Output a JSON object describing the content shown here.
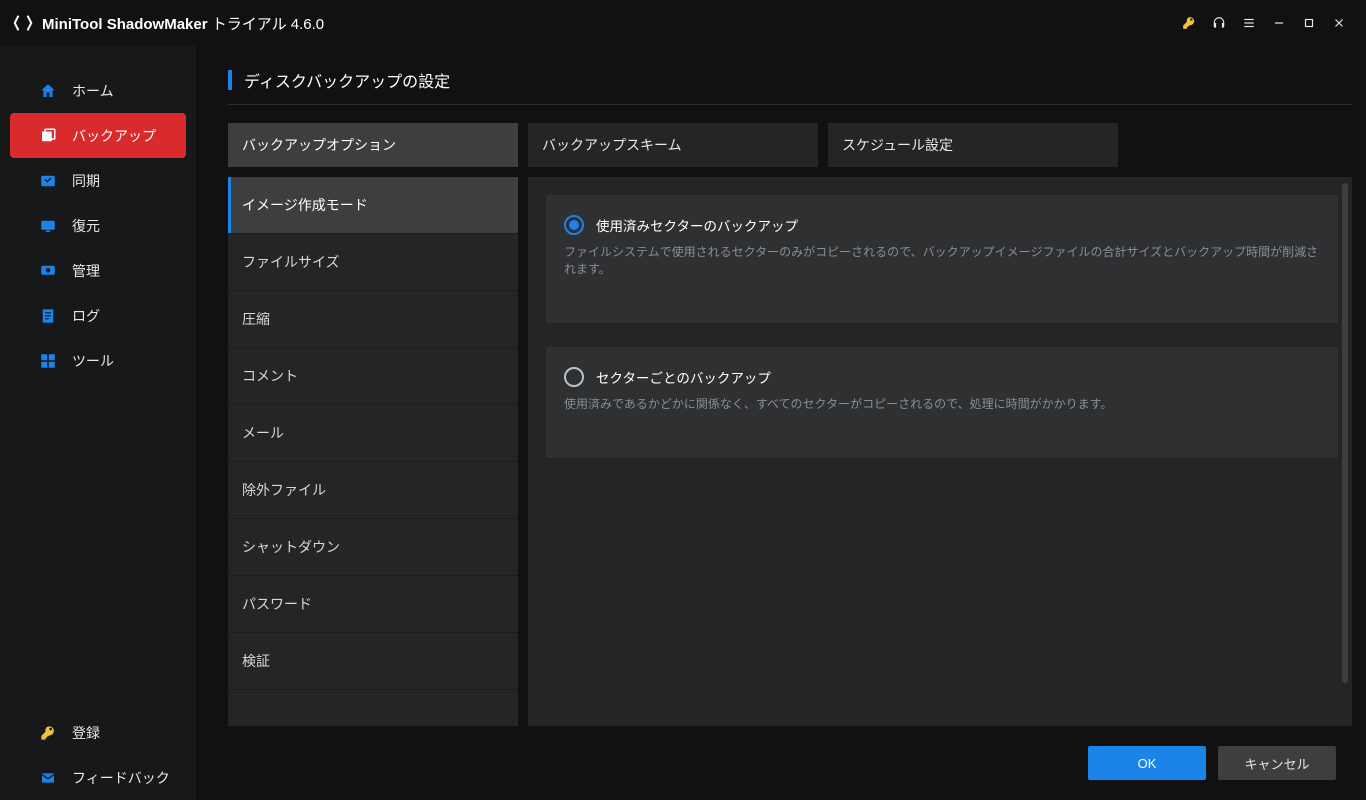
{
  "app": {
    "name_bold": "MiniTool ShadowMaker",
    "name_light": " トライアル 4.6.0"
  },
  "sidebar": {
    "items": [
      {
        "label": "ホーム"
      },
      {
        "label": "バックアップ"
      },
      {
        "label": "同期"
      },
      {
        "label": "復元"
      },
      {
        "label": "管理"
      },
      {
        "label": "ログ"
      },
      {
        "label": "ツール"
      }
    ],
    "bottom": [
      {
        "label": "登録"
      },
      {
        "label": "フィードバック"
      }
    ]
  },
  "page": {
    "title": "ディスクバックアップの設定"
  },
  "tabs": [
    {
      "label": "バックアップオプション"
    },
    {
      "label": "バックアップスキーム"
    },
    {
      "label": "スケジュール設定"
    }
  ],
  "options_list": [
    {
      "label": "イメージ作成モード"
    },
    {
      "label": "ファイルサイズ"
    },
    {
      "label": "圧縮"
    },
    {
      "label": "コメント"
    },
    {
      "label": "メール"
    },
    {
      "label": "除外ファイル"
    },
    {
      "label": "シャットダウン"
    },
    {
      "label": "パスワード"
    },
    {
      "label": "検証"
    }
  ],
  "mode_options": [
    {
      "label": "使用済みセクターのバックアップ",
      "desc": "ファイルシステムで使用されるセクターのみがコピーされるので、バックアップイメージファイルの合計サイズとバックアップ時間が削減されます。",
      "checked": true
    },
    {
      "label": "セクターごとのバックアップ",
      "desc": "使用済みであるかどかに関係なく、すべてのセクターがコピーされるので、処理に時間がかかります。",
      "checked": false
    }
  ],
  "buttons": {
    "ok": "OK",
    "cancel": "キャンセル"
  }
}
